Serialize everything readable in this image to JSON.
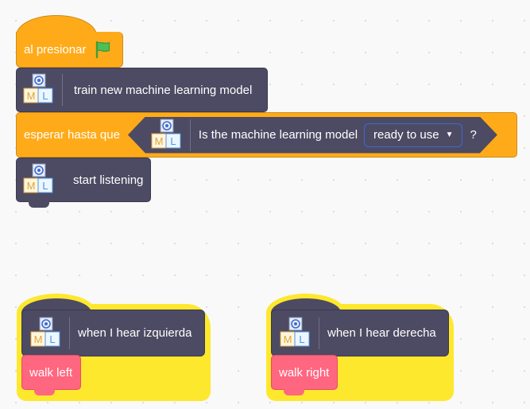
{
  "workspace": {
    "event_flag": {
      "label": "al presionar",
      "icon": "green-flag-icon",
      "color": "#ffab19"
    },
    "script": [
      {
        "label": "train new machine learning model",
        "icon": "ml-extension-icon"
      },
      {
        "label": "start listening",
        "icon": "ml-extension-icon"
      }
    ],
    "wait_block": {
      "label": "esperar hasta que",
      "reporter": {
        "label": "Is the machine learning model",
        "dropdown_value": "ready to use",
        "suffix": "?"
      }
    },
    "hear_left": {
      "label": "when I hear izquierda",
      "icon": "ml-extension-icon",
      "action": "walk left"
    },
    "hear_right": {
      "label": "when I hear derecha",
      "icon": "ml-extension-icon",
      "action": "walk right"
    },
    "colors": {
      "events": "#ffab19",
      "ml_extension": "#4d4a63",
      "custom_block": "#ff6680",
      "glow": "#fde82e",
      "dropdown_border": "#3d6bd0"
    }
  }
}
